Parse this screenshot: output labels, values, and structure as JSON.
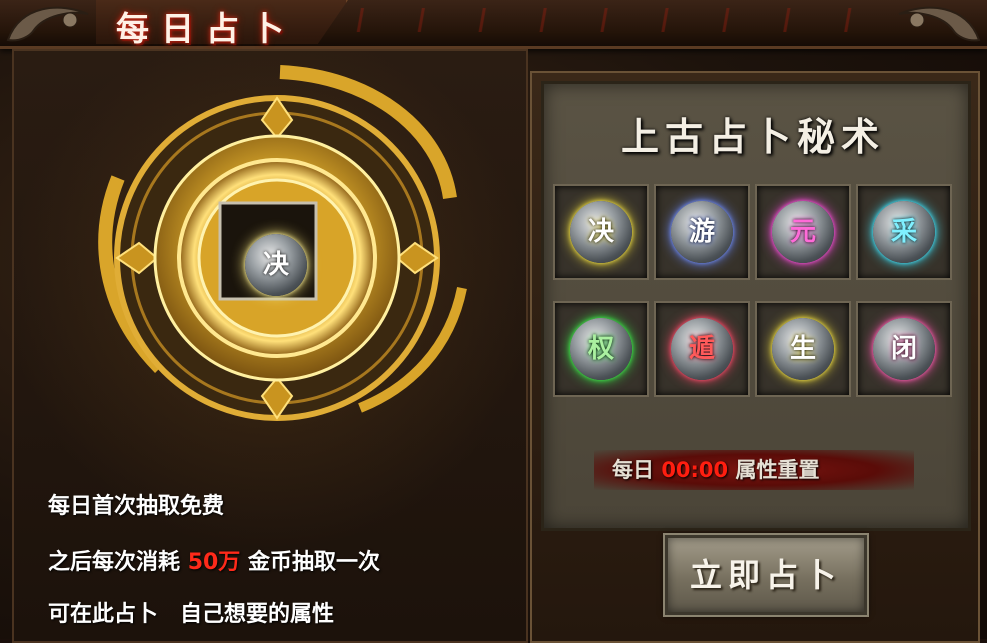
{
  "window": {
    "title": "每日占卜"
  },
  "center_stone": {
    "glyph": "决",
    "glow": "#f2e27a"
  },
  "description": {
    "line1": "每日首次抽取免费",
    "line2_prefix": "之后每次消耗",
    "line2_cost": "50万",
    "line2_suffix": "金币抽取一次",
    "line3": "可在此占卜　自己想要的属性"
  },
  "secret_panel": {
    "title": "上古占卜秘术",
    "stones": [
      {
        "glyph": "决",
        "glow": "#f2e040",
        "text_color": "#ffffff"
      },
      {
        "glyph": "游",
        "glow": "#6f8dff",
        "text_color": "#ffffff"
      },
      {
        "glyph": "元",
        "glow": "#ff4fe0",
        "text_color": "#ff6ad8"
      },
      {
        "glyph": "采",
        "glow": "#40e6ff",
        "text_color": "#7ff0ff"
      },
      {
        "glyph": "权",
        "glow": "#3cf04a",
        "text_color": "#aaf0a0"
      },
      {
        "glyph": "遁",
        "glow": "#ff4a6a",
        "text_color": "#ff5a5a"
      },
      {
        "glyph": "生",
        "glow": "#f2e040",
        "text_color": "#ffffff"
      },
      {
        "glyph": "闭",
        "glow": "#ff5ab0",
        "text_color": "#ffffff"
      }
    ],
    "reset_prefix": "每日",
    "reset_time": "00:00",
    "reset_suffix": "属性重置"
  },
  "divine_button": {
    "label": "立即占卜"
  },
  "colors": {
    "gold": "#e8b630",
    "cost_red": "#ff2a1a"
  }
}
